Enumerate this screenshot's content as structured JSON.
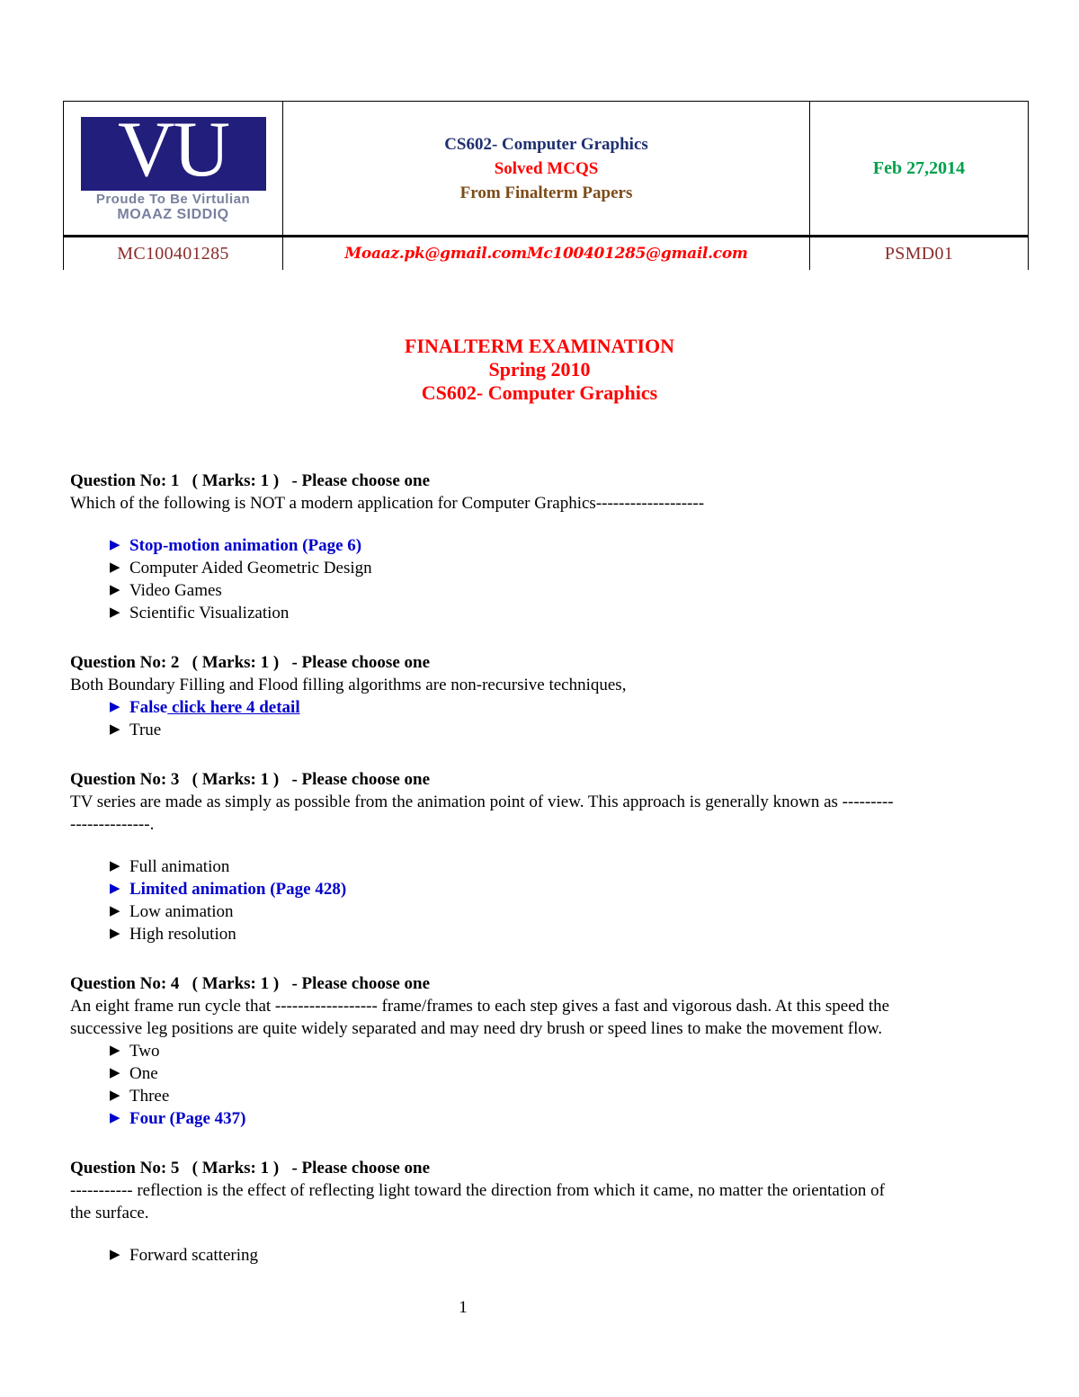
{
  "header": {
    "logo": {
      "letters": "VU",
      "tagline1": "Proude To Be Virtulian",
      "tagline2": "MOAAZ SIDDIQ",
      "box_color": "#221E7C",
      "tagline_color": "#78819E"
    },
    "title_line_1": "CS602- Computer Graphics",
    "title_line_2": "Solved MCQS",
    "title_line_3": "From Finalterm Papers",
    "title_color_1": "#1F3070",
    "title_color_2": "#FF0000",
    "title_color_3": "#7B4B17",
    "date": "Feb 27,2014",
    "date_color": "#00A14B",
    "student_id": "MC100401285",
    "email_1": "Moaaz.pk@gmail.com",
    "email_2": "Mc100401285@gmail.com",
    "email_color": "#FF0000",
    "code": "PSMD01",
    "id_color": "#8C2B2B"
  },
  "exam": {
    "line_1": "FINALTERM EXAMINATION",
    "line_2": "Spring 2010",
    "line_3": "CS602- Computer Graphics",
    "color": "#FF0000"
  },
  "questions": [
    {
      "head": "Question No: 1   ( Marks: 1 )   - Please choose one",
      "text": "Which of the following is NOT a modern application for Computer Graphics-------------------",
      "options": [
        {
          "label": "Stop-motion animation (Page 6)",
          "correct": true
        },
        {
          "label": "Computer Aided Geometric Design",
          "correct": false
        },
        {
          "label": "Video Games",
          "correct": false
        },
        {
          "label": "Scientific Visualization",
          "correct": false
        }
      ]
    },
    {
      "head": "Question No: 2   ( Marks: 1 )   - Please choose one",
      "text": "Both Boundary Filling and Flood filling algorithms are non-recursive techniques,",
      "options": [
        {
          "label": "False",
          "correct": true,
          "link": "click here 4 detail"
        },
        {
          "label": "True",
          "correct": false
        }
      ]
    },
    {
      "head": "Question No: 3   ( Marks: 1 )   - Please choose one",
      "text": "TV series are made as simply as possible from the animation point of view. This approach is generally known as ---------",
      "text2": "--------------.",
      "options": [
        {
          "label": "Full animation",
          "correct": false
        },
        {
          "label": "Limited animation (Page 428)",
          "correct": true
        },
        {
          "label": "Low animation",
          "correct": false
        },
        {
          "label": "High resolution",
          "correct": false
        }
      ]
    },
    {
      "head": "Question No: 4   ( Marks: 1 )   - Please choose one",
      "text": "An eight frame run cycle that ------------------ frame/frames to each step gives a fast and vigorous dash. At this speed the",
      "text2": "successive leg positions are quite widely separated and may need dry brush or speed lines to make the movement flow.",
      "options": [
        {
          "label": "Two",
          "correct": false
        },
        {
          "label": "One",
          "correct": false
        },
        {
          "label": "Three",
          "correct": false
        },
        {
          "label": "Four (Page 437)",
          "correct": true
        }
      ]
    },
    {
      "head": "Question No: 5   ( Marks: 1 )   - Please choose one",
      "text": "----------- reflection is the effect of reflecting light toward the direction from which it came, no matter the orientation of",
      "text2": "the surface.",
      "options": [
        {
          "label": "Forward scattering",
          "correct": false
        }
      ]
    }
  ],
  "footer": {
    "page_number": "1"
  },
  "icons": {
    "bullet_triangle": "▶"
  }
}
